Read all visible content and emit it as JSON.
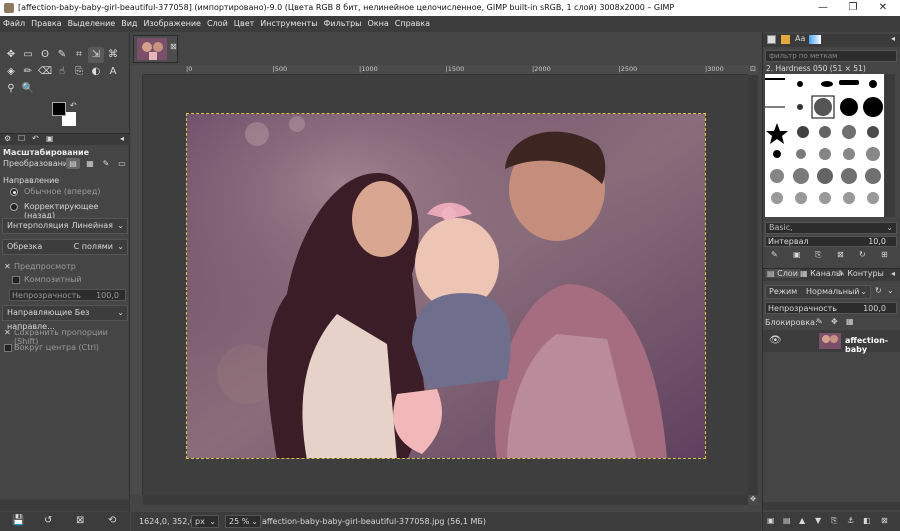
{
  "window": {
    "title": "[affection-baby-baby-girl-beautiful-377058] (импортировано)-9.0 (Цвета RGB 8 бит, нелинейное целочисленное, GIMP built-in sRGB, 1 слой) 3008x2000 – GIMP",
    "min_glyph": "—",
    "max_glyph": "❐",
    "close_glyph": "✕"
  },
  "menu": [
    "Файл",
    "Правка",
    "Выделение",
    "Вид",
    "Изображение",
    "Слой",
    "Цвет",
    "Инструменты",
    "Фильтры",
    "Окна",
    "Справка"
  ],
  "toolbox": {
    "tools": [
      {
        "icon": "move-icon",
        "glyph": "✥"
      },
      {
        "icon": "rect-select-icon",
        "glyph": "▭"
      },
      {
        "icon": "lasso-icon",
        "glyph": "ʘ"
      },
      {
        "icon": "fuzzy-select-icon",
        "glyph": "✎"
      },
      {
        "icon": "crop-icon",
        "glyph": "⌗"
      },
      {
        "icon": "scale-icon",
        "glyph": "⇲",
        "selected": true
      },
      {
        "icon": "warp-icon",
        "glyph": "⌘"
      },
      {
        "icon": "bucket-fill-icon",
        "glyph": "◈"
      },
      {
        "icon": "paintbrush-icon",
        "glyph": "✏"
      },
      {
        "icon": "eraser-icon",
        "glyph": "⌫"
      },
      {
        "icon": "smudge-icon",
        "glyph": "☝"
      },
      {
        "icon": "clone-icon",
        "glyph": "⎘"
      },
      {
        "icon": "dodge-icon",
        "glyph": "◐"
      },
      {
        "icon": "text-icon",
        "glyph": "A"
      },
      {
        "icon": "color-picker-icon",
        "glyph": "⚲"
      },
      {
        "icon": "zoom-icon",
        "glyph": "🔍"
      }
    ]
  },
  "tool_options": {
    "title": "Масштабирование",
    "transform_label": "Преобразование:",
    "direction_label": "Направление",
    "dir_normal": "Обычное (вперед)",
    "dir_corrective": "Корректирующее (назад)",
    "interp_label": "Интерполяция",
    "interp_value": "Линейная",
    "clip_label": "Обрезка",
    "clip_value": "С полями",
    "preview": "Предпросмотр",
    "composite": "Композитный",
    "opacity_label": "Непрозрачность",
    "opacity_value": "100,0",
    "guides": "Направляющие Без направле...",
    "keep_aspect": "Сохранить пропорции (Shift)",
    "around_center": "Вокруг центра (Ctrl)"
  },
  "ruler": {
    "ticks": [
      "|0",
      "|500",
      "|1000",
      "|1500",
      "|2000",
      "|2500",
      "|3000"
    ]
  },
  "status": {
    "coords": "1624,0, 352,0",
    "unit": "px",
    "zoom": "25 %",
    "file": "affection-baby-baby-girl-beautiful-377058.jpg (56,1 МБ)"
  },
  "brushes": {
    "filter_placeholder": "фильтр по меткам",
    "current": "2. Hardness 050 (51 × 51)",
    "tag_value": "Basic,",
    "spacing_label": "Интервал",
    "spacing_value": "10,0"
  },
  "layers": {
    "tabs": [
      "Слои",
      "Каналы",
      "Контуры"
    ],
    "mode_label": "Режим",
    "mode_value": "Нормальный",
    "opacity_label": "Непрозрачность",
    "opacity_value": "100,0",
    "lock_label": "Блокировка:",
    "layer_name": "affection-baby"
  },
  "colors": {
    "fg": "#000000",
    "bg": "#ffffff",
    "marching": "#e0c24a"
  }
}
